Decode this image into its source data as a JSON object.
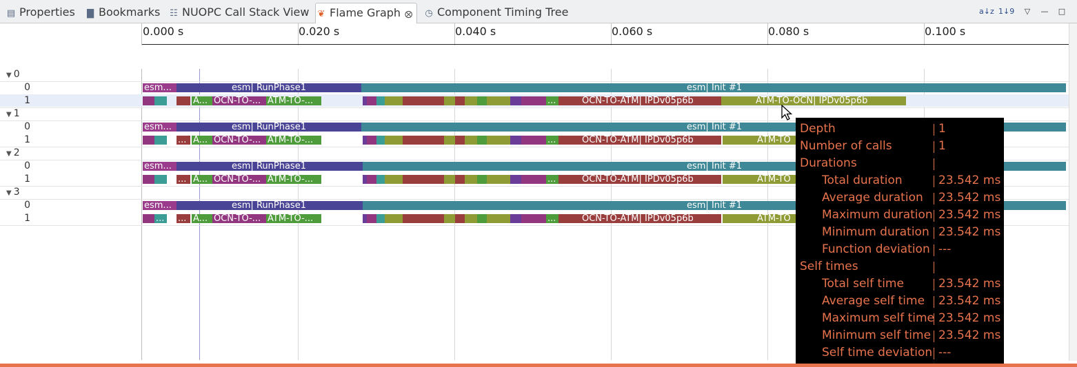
{
  "tabs": [
    {
      "label": "Properties",
      "icon": "properties-icon",
      "glyph": "▤"
    },
    {
      "label": "Bookmarks",
      "icon": "bookmarks-icon",
      "glyph": "▇"
    },
    {
      "label": "NUOPC Call Stack View",
      "icon": "callstack-icon",
      "glyph": "☷"
    },
    {
      "label": "Flame Graph",
      "icon": "flame-icon",
      "glyph": "❦",
      "active": true
    },
    {
      "label": "Component Timing Tree",
      "icon": "clock-icon",
      "glyph": "◷"
    }
  ],
  "toolbar": {
    "sort_alpha": "a↓z",
    "sort_numeric": "1↓9",
    "menu": "▽",
    "minimize": "—",
    "maximize": "□"
  },
  "ruler": {
    "ticks": [
      "0.000 s",
      "0.020 s",
      "0.040 s",
      "0.060 s",
      "0.080 s",
      "0.100 s"
    ]
  },
  "groups": [
    {
      "label": "0",
      "rows": [
        "0",
        "1"
      ]
    },
    {
      "label": "1",
      "rows": [
        "0",
        "1"
      ]
    },
    {
      "label": "2",
      "rows": [
        "0",
        "1"
      ]
    },
    {
      "label": "3",
      "rows": [
        "0",
        "1"
      ]
    }
  ],
  "bar_labels": {
    "esm_short": "esm...",
    "runphase": "esm| RunPhase1",
    "init": "esm| Init #1",
    "a_short": "A...",
    "ellipsis": "...",
    "ocn_to_short": "OCN-TO-...",
    "atm_to_short": "ATM-TO-...",
    "ocn_to_atm": "OCN-TO-ATM| IPDv05p6b",
    "atm_to_ocn": "ATM-TO-OCN| IPDv05p6b",
    "atm_to_trunc": "ATM-TO"
  },
  "colors": {
    "esm": "#9a3b8c",
    "runphase": "#4a4496",
    "init": "#3e8897",
    "teal": "#3c9c96",
    "red": "#9a3d3d",
    "green": "#4e9c3c",
    "olive": "#8f9c35",
    "purple": "#92367f",
    "violet": "#6a3d99",
    "highlight_row": "#e8eef9",
    "tooltip_text": "#e7734d"
  },
  "tooltip": {
    "rows": [
      {
        "key": "Depth",
        "value": "1",
        "indent": false
      },
      {
        "key": "Number of calls",
        "value": "1",
        "indent": false
      },
      {
        "key": "Durations",
        "value": "",
        "indent": false
      },
      {
        "key": "Total duration",
        "value": "23.542 ms",
        "indent": true
      },
      {
        "key": "Average duration",
        "value": "23.542 ms",
        "indent": true
      },
      {
        "key": "Maximum duration",
        "value": "23.542 ms",
        "indent": true
      },
      {
        "key": "Minimum duration",
        "value": "23.542 ms",
        "indent": true
      },
      {
        "key": "Function deviation",
        "value": "---",
        "indent": true
      },
      {
        "key": "Self times",
        "value": "",
        "indent": false
      },
      {
        "key": "Total self time",
        "value": "23.542 ms",
        "indent": true
      },
      {
        "key": "Average self time",
        "value": "23.542 ms",
        "indent": true
      },
      {
        "key": "Maximum self time",
        "value": "23.542 ms",
        "indent": true
      },
      {
        "key": "Minimum self time",
        "value": "23.542 ms",
        "indent": true
      },
      {
        "key": "Self time deviation",
        "value": "---",
        "indent": true
      }
    ]
  }
}
